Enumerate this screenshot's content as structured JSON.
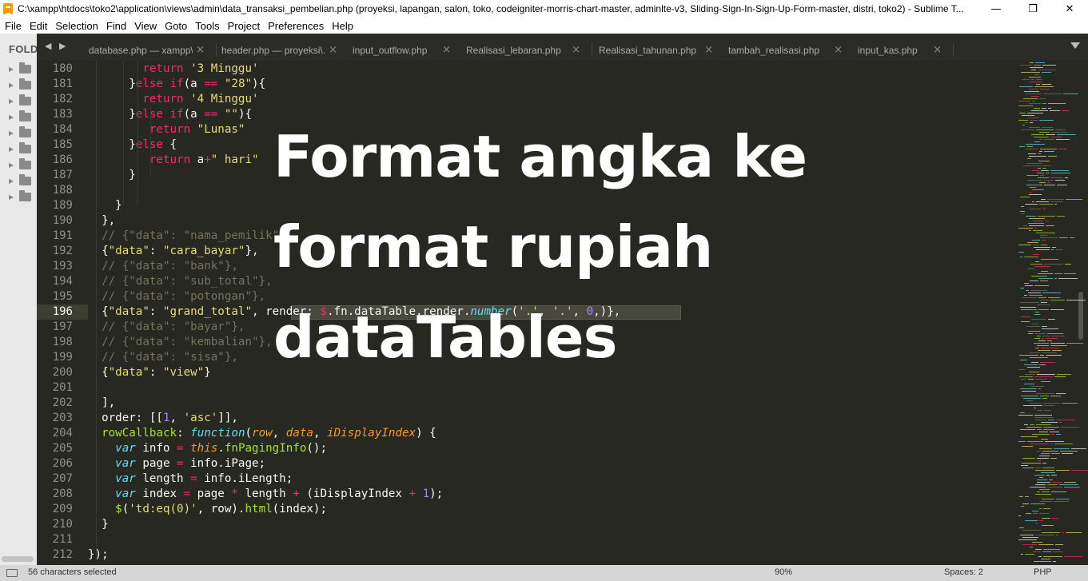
{
  "window": {
    "title": "C:\\xampp\\htdocs\\toko2\\application\\views\\admin\\data_transaksi_pembelian.php (proyeksi, lapangan, salon, toko, codeigniter-morris-chart-master, adminlte-v3, Sliding-Sign-In-Sign-Up-Form-master, distri, toko2) - Sublime T...",
    "minimize": "—",
    "maximize": "❐",
    "close": "✕"
  },
  "menu": [
    "File",
    "Edit",
    "Selection",
    "Find",
    "View",
    "Goto",
    "Tools",
    "Project",
    "Preferences",
    "Help"
  ],
  "sidebar": {
    "header": "FOLDERS",
    "folder_count": 9
  },
  "tabs": [
    {
      "label": "database.php — xampp\\...\\config",
      "close": "×"
    },
    {
      "label": "header.php — proyeksi\\...\\admin",
      "close": "×"
    },
    {
      "label": "input_outflow.php",
      "close": "×"
    },
    {
      "label": "Realisasi_lebaran.php",
      "close": "×"
    },
    {
      "label": "Realisasi_tahunan.php",
      "close": "×"
    },
    {
      "label": "tambah_realisasi.php",
      "close": "×"
    },
    {
      "label": "input_kas.php",
      "close": "×"
    }
  ],
  "tab_nav": "◀ ▶",
  "editor": {
    "active_line": "196",
    "lines": [
      {
        "n": "180",
        "segs": [
          [
            "",
            "        "
          ],
          [
            "kw",
            "return"
          ],
          [
            "",
            " "
          ],
          [
            "str",
            "'3 Minggu'"
          ]
        ]
      },
      {
        "n": "181",
        "segs": [
          [
            "",
            "      }"
          ],
          [
            "kw",
            "else if"
          ],
          [
            "",
            "(a "
          ],
          [
            "kw",
            "=="
          ],
          [
            "",
            " "
          ],
          [
            "str",
            "\"28\""
          ],
          [
            "",
            "){"
          ]
        ]
      },
      {
        "n": "182",
        "segs": [
          [
            "",
            "        "
          ],
          [
            "kw",
            "return"
          ],
          [
            "",
            " "
          ],
          [
            "str",
            "'4 Minggu'"
          ]
        ]
      },
      {
        "n": "183",
        "segs": [
          [
            "",
            "      }"
          ],
          [
            "kw",
            "else if"
          ],
          [
            "",
            "(a "
          ],
          [
            "kw",
            "=="
          ],
          [
            "",
            " "
          ],
          [
            "str",
            "\"\""
          ],
          [
            "",
            "){"
          ]
        ]
      },
      {
        "n": "184",
        "segs": [
          [
            "",
            "         "
          ],
          [
            "kw",
            "return"
          ],
          [
            "",
            " "
          ],
          [
            "str",
            "\"Lunas\""
          ]
        ]
      },
      {
        "n": "185",
        "segs": [
          [
            "",
            "      }"
          ],
          [
            "kw",
            "else"
          ],
          [
            "",
            " {"
          ]
        ]
      },
      {
        "n": "186",
        "segs": [
          [
            "",
            "         "
          ],
          [
            "kw",
            "return"
          ],
          [
            "",
            " a"
          ],
          [
            "kw",
            "+"
          ],
          [
            "str",
            "\" hari\""
          ]
        ]
      },
      {
        "n": "187",
        "segs": [
          [
            "",
            "      }"
          ]
        ]
      },
      {
        "n": "188",
        "segs": []
      },
      {
        "n": "189",
        "segs": [
          [
            "",
            "    }"
          ]
        ]
      },
      {
        "n": "190",
        "segs": [
          [
            "",
            "  },"
          ]
        ]
      },
      {
        "n": "191",
        "segs": [
          [
            "",
            "  "
          ],
          [
            "cm",
            "// {\"data\": \"nama_pemilik\"},"
          ]
        ]
      },
      {
        "n": "192",
        "segs": [
          [
            "",
            "  {"
          ],
          [
            "str",
            "\"data\""
          ],
          [
            "",
            ": "
          ],
          [
            "str",
            "\"cara_bayar\""
          ],
          [
            "",
            "},"
          ]
        ]
      },
      {
        "n": "193",
        "segs": [
          [
            "",
            "  "
          ],
          [
            "cm",
            "// {\"data\": \"bank\"},"
          ]
        ]
      },
      {
        "n": "194",
        "segs": [
          [
            "",
            "  "
          ],
          [
            "cm",
            "// {\"data\": \"sub_total\"},"
          ]
        ]
      },
      {
        "n": "195",
        "segs": [
          [
            "",
            "  "
          ],
          [
            "cm",
            "// {\"data\": \"potongan\"},"
          ]
        ]
      },
      {
        "n": "196",
        "segs": [
          [
            "",
            "  {"
          ],
          [
            "str",
            "\"data\""
          ],
          [
            "",
            ": "
          ],
          [
            "str",
            "\"grand_total\""
          ],
          [
            "",
            ", render: "
          ],
          [
            "kw",
            "$"
          ],
          [
            "",
            ".fn.dataTable.render."
          ],
          [
            "tp",
            "number"
          ],
          [
            "",
            "("
          ],
          [
            "str",
            "'.'"
          ],
          [
            "",
            ", "
          ],
          [
            "str",
            "'.'"
          ],
          [
            "",
            ", "
          ],
          [
            "num",
            "0"
          ],
          [
            "",
            ",)},"
          ]
        ]
      },
      {
        "n": "197",
        "segs": [
          [
            "",
            "  "
          ],
          [
            "cm",
            "// {\"data\": \"bayar\"},"
          ]
        ]
      },
      {
        "n": "198",
        "segs": [
          [
            "",
            "  "
          ],
          [
            "cm",
            "// {\"data\": \"kembalian\"},"
          ]
        ]
      },
      {
        "n": "199",
        "segs": [
          [
            "",
            "  "
          ],
          [
            "cm",
            "// {\"data\": \"sisa\"},"
          ]
        ]
      },
      {
        "n": "200",
        "segs": [
          [
            "",
            "  {"
          ],
          [
            "str",
            "\"data\""
          ],
          [
            "",
            ": "
          ],
          [
            "str",
            "\"view\""
          ],
          [
            "",
            "}"
          ]
        ]
      },
      {
        "n": "201",
        "segs": []
      },
      {
        "n": "202",
        "segs": [
          [
            "",
            "  ],"
          ]
        ]
      },
      {
        "n": "203",
        "segs": [
          [
            "",
            "  order: [["
          ],
          [
            "num",
            "1"
          ],
          [
            "",
            ", "
          ],
          [
            "str",
            "'asc'"
          ],
          [
            "",
            "]],"
          ]
        ]
      },
      {
        "n": "204",
        "segs": [
          [
            "",
            "  "
          ],
          [
            "fn",
            "rowCallback"
          ],
          [
            "",
            ": "
          ],
          [
            "tp",
            "function"
          ],
          [
            "",
            "("
          ],
          [
            "prm",
            "row"
          ],
          [
            "",
            ", "
          ],
          [
            "prm",
            "data"
          ],
          [
            "",
            ", "
          ],
          [
            "prm",
            "iDisplayIndex"
          ],
          [
            "",
            ") {"
          ]
        ]
      },
      {
        "n": "205",
        "segs": [
          [
            "",
            "    "
          ],
          [
            "tp",
            "var"
          ],
          [
            "",
            " info "
          ],
          [
            "kw",
            "="
          ],
          [
            "",
            " "
          ],
          [
            "prm",
            "this"
          ],
          [
            "",
            "."
          ],
          [
            "fn",
            "fnPagingInfo"
          ],
          [
            "",
            "();"
          ]
        ]
      },
      {
        "n": "206",
        "segs": [
          [
            "",
            "    "
          ],
          [
            "tp",
            "var"
          ],
          [
            "",
            " page "
          ],
          [
            "kw",
            "="
          ],
          [
            "",
            " info.iPage;"
          ]
        ]
      },
      {
        "n": "207",
        "segs": [
          [
            "",
            "    "
          ],
          [
            "tp",
            "var"
          ],
          [
            "",
            " length "
          ],
          [
            "kw",
            "="
          ],
          [
            "",
            " info.iLength;"
          ]
        ]
      },
      {
        "n": "208",
        "segs": [
          [
            "",
            "    "
          ],
          [
            "tp",
            "var"
          ],
          [
            "",
            " index "
          ],
          [
            "kw",
            "="
          ],
          [
            "",
            " page "
          ],
          [
            "kw",
            "*"
          ],
          [
            "",
            " length "
          ],
          [
            "kw",
            "+"
          ],
          [
            "",
            " (iDisplayIndex "
          ],
          [
            "kw",
            "+"
          ],
          [
            "",
            " "
          ],
          [
            "num",
            "1"
          ],
          [
            "",
            ");"
          ]
        ]
      },
      {
        "n": "209",
        "segs": [
          [
            "",
            "    "
          ],
          [
            "fn",
            "$"
          ],
          [
            "",
            "("
          ],
          [
            "str",
            "'td:eq(0)'"
          ],
          [
            "",
            ", row)."
          ],
          [
            "fn",
            "html"
          ],
          [
            "",
            "(index);"
          ]
        ]
      },
      {
        "n": "210",
        "segs": [
          [
            "",
            "  }"
          ]
        ]
      },
      {
        "n": "211",
        "segs": []
      },
      {
        "n": "212",
        "segs": [
          [
            "",
            "});"
          ]
        ]
      }
    ]
  },
  "overlay": {
    "line1": "Format angka ke",
    "line2": "format rupiah",
    "line3": "dataTables"
  },
  "status": {
    "selection": "56 characters selected",
    "zoom": "90%",
    "spaces": "Spaces: 2",
    "syntax": "PHP"
  },
  "colors": {
    "background": "#272822",
    "keyword": "#f92672",
    "string": "#e6db74",
    "number": "#ae81ff",
    "comment": "#75715e",
    "function": "#a6e22e",
    "type": "#66d9ef",
    "parameter": "#fd971f"
  }
}
